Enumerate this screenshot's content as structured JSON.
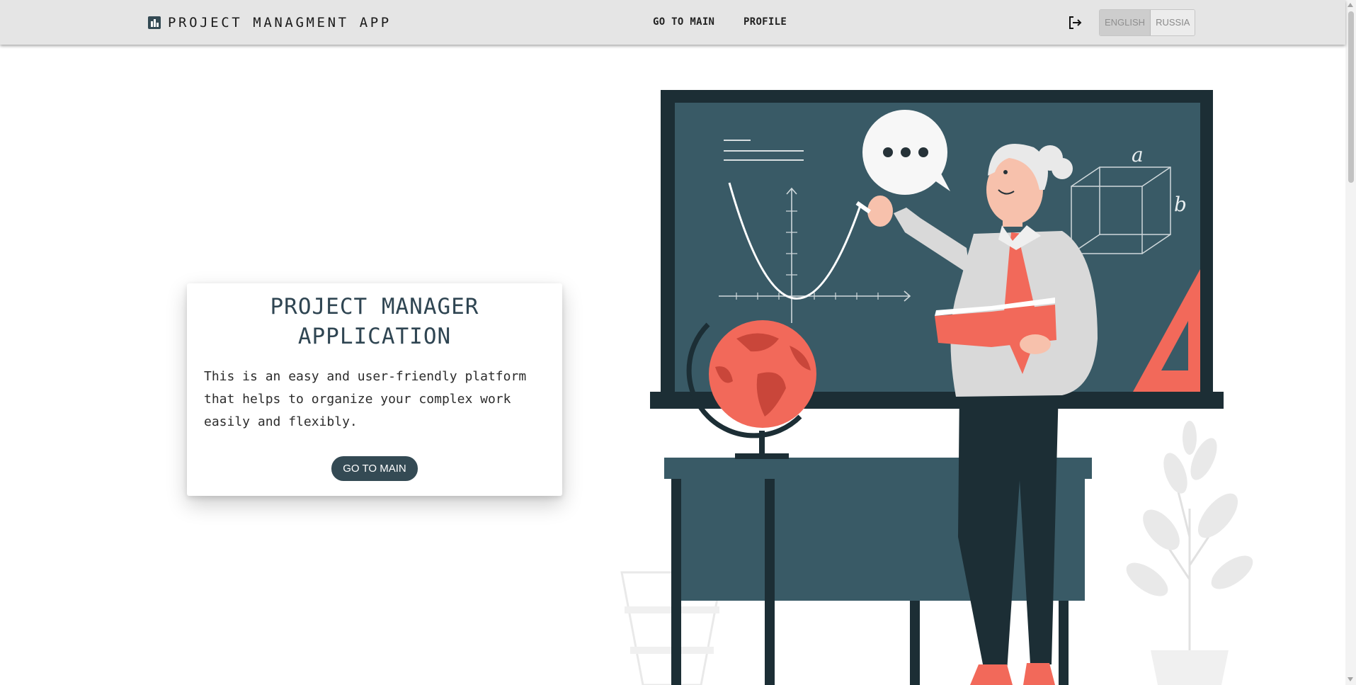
{
  "header": {
    "app_title": "PROJECT MANAGMENT APP",
    "nav": {
      "go_to_main": "GO TO MAIN",
      "profile": "PROFILE"
    },
    "languages": [
      {
        "label": "ENGLISH",
        "selected": true
      },
      {
        "label": "RUSSIA",
        "selected": false
      }
    ]
  },
  "hero": {
    "title": "PROJECT MANAGER APPLICATION",
    "description": "This is an easy and user-friendly platform that helps to organize your complex work easily and flexibly.",
    "button_label": "GO TO MAIN"
  },
  "illustration": {
    "board_labels": {
      "a": "a",
      "b": "b"
    }
  },
  "icons": {
    "logo": "bar-chart-icon",
    "logout": "logout-icon"
  },
  "colors": {
    "accent_dark": "#344a54",
    "accent_orange": "#f2695a",
    "header_bg": "#e5e5e5"
  }
}
